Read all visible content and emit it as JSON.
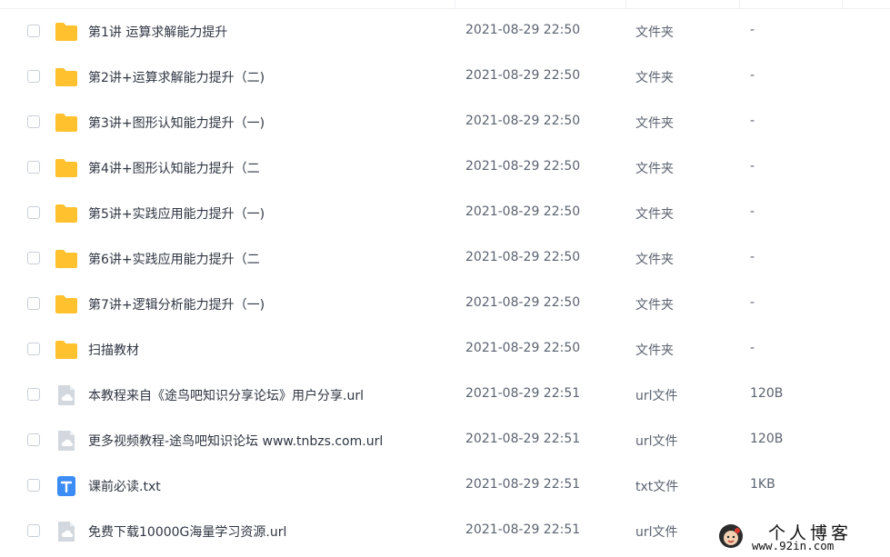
{
  "files": [
    {
      "name": "第1讲 运算求解能力提升",
      "modified": "2021-08-29 22:50",
      "type": "文件夹",
      "size": "-",
      "icon": "folder-icon"
    },
    {
      "name": "第2讲+运算求解能力提升（二)",
      "modified": "2021-08-29 22:50",
      "type": "文件夹",
      "size": "-",
      "icon": "folder-icon"
    },
    {
      "name": "第3讲+图形认知能力提升（一)",
      "modified": "2021-08-29 22:50",
      "type": "文件夹",
      "size": "-",
      "icon": "folder-icon"
    },
    {
      "name": "第4讲+图形认知能力提升（二",
      "modified": "2021-08-29 22:50",
      "type": "文件夹",
      "size": "-",
      "icon": "folder-icon"
    },
    {
      "name": "第5讲+实践应用能力提升（一)",
      "modified": "2021-08-29 22:50",
      "type": "文件夹",
      "size": "-",
      "icon": "folder-icon"
    },
    {
      "name": "第6讲+实践应用能力提升（二",
      "modified": "2021-08-29 22:50",
      "type": "文件夹",
      "size": "-",
      "icon": "folder-icon"
    },
    {
      "name": "第7讲+逻辑分析能力提升（一)",
      "modified": "2021-08-29 22:50",
      "type": "文件夹",
      "size": "-",
      "icon": "folder-icon"
    },
    {
      "name": "扫描教材",
      "modified": "2021-08-29 22:50",
      "type": "文件夹",
      "size": "-",
      "icon": "folder-icon"
    },
    {
      "name": "本教程来自《途鸟吧知识分享论坛》用户分享.url",
      "modified": "2021-08-29 22:51",
      "type": "url文件",
      "size": "120B",
      "icon": "url-file-icon"
    },
    {
      "name": "更多视频教程-途鸟吧知识论坛 www.tnbzs.com.url",
      "modified": "2021-08-29 22:51",
      "type": "url文件",
      "size": "120B",
      "icon": "url-file-icon"
    },
    {
      "name": "课前必读.txt",
      "modified": "2021-08-29 22:51",
      "type": "txt文件",
      "size": "1KB",
      "icon": "txt-file-icon"
    },
    {
      "name": "免费下载10000G海量学习资源.url",
      "modified": "2021-08-29 22:51",
      "type": "url文件",
      "size": "",
      "icon": "url-file-icon"
    }
  ],
  "watermark": {
    "title": "个人博客",
    "url": "www.92in.com"
  },
  "colors": {
    "folder": "#ffc12e",
    "url_file": "#d3d8de",
    "txt_file": "#3b8cf5"
  }
}
